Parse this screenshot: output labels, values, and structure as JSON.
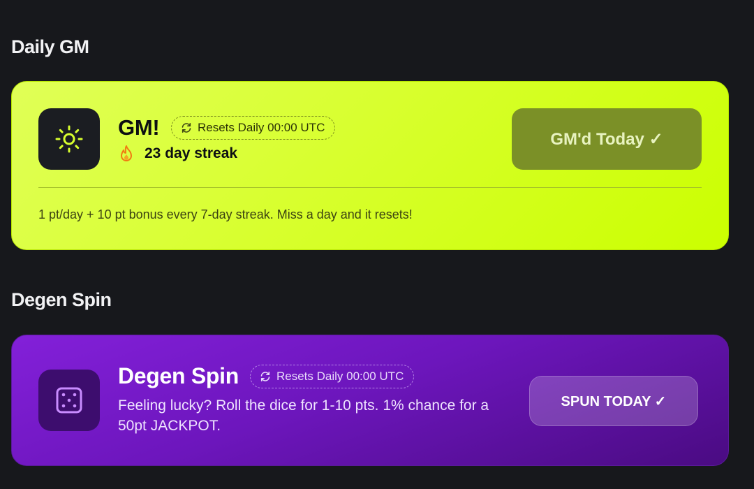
{
  "sections": {
    "gm_title": "Daily GM",
    "spin_title": "Degen Spin"
  },
  "gm_card": {
    "icon": "sun-icon",
    "heading": "GM!",
    "reset_label": "Resets Daily 00:00 UTC",
    "streak_icon": "flame-icon",
    "streak_text": "23 day streak",
    "button_label": "GM'd Today ✓",
    "description": "1 pt/day + 10 pt bonus every 7-day streak. Miss a day and it resets!",
    "accent": "#d8ff2e",
    "icon_color": "#d8ff2e"
  },
  "spin_card": {
    "icon": "dice-icon",
    "heading": "Degen Spin",
    "reset_label": "Resets Daily 00:00 UTC",
    "description": "Feeling lucky? Roll the dice for 1-10 pts. 1% chance for a 50pt JACKPOT.",
    "button_label": "SPUN TODAY ✓",
    "accent": "#7a1bd2",
    "icon_color": "#c98cff"
  }
}
